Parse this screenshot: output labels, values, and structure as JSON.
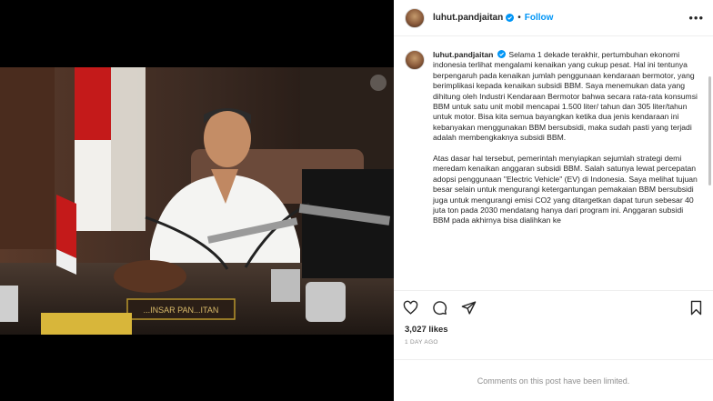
{
  "post": {
    "username": "luhut.pandjaitan",
    "follow_label": "Follow",
    "more_label": "•••",
    "caption_paragraphs": [
      "Selama 1 dekade terakhir, pertumbuhan ekonomi indonesia terlihat mengalami kenaikan yang cukup pesat. Hal ini tentunya berpengaruh pada kenaikan jumlah penggunaan kendaraan bermotor, yang berimplikasi kepada kenaikan subsidi BBM. Saya menemukan data yang dihitung oleh Industri Kendaraan Bermotor bahwa secara rata-rata konsumsi BBM untuk satu unit mobil mencapai 1.500 liter/ tahun dan 305 liter/tahun untuk motor. Bisa kita semua bayangkan ketika dua jenis kendaraan ini kebanyakan menggunakan BBM bersubsidi, maka sudah pasti yang terjadi adalah membengkaknya subsidi BBM.",
      "Atas dasar hal tersebut, pemerintah menyiapkan sejumlah strategi demi meredam kenaikan anggaran subsidi BBM. Salah satunya lewat percepatan adopsi penggunaan \"Electric Vehicle\" (EV) di Indonesia. Saya melihat tujuan besar selain untuk mengurangi ketergantungan pemakaian BBM bersubsidi juga untuk mengurangi emisi CO2 yang ditargetkan dapat turun sebesar 40 juta ton pada 2030 mendatang hanya dari program ini. Anggaran subsidi BBM pada akhirnya bisa dialihkan ke"
    ],
    "likes": "3,027 likes",
    "posted_ago": "1 DAY AGO",
    "comments_disabled": "Comments on this post have been limited."
  },
  "photo": {
    "nameplate_text": "...INSAR PAN...ITAN"
  },
  "icons": [
    "verified-icon",
    "heart-icon",
    "comment-icon",
    "share-icon",
    "bookmark-icon",
    "more-icon"
  ],
  "colors": {
    "accent": "#0095f6",
    "text": "#262626",
    "muted": "#8e8e8e"
  }
}
